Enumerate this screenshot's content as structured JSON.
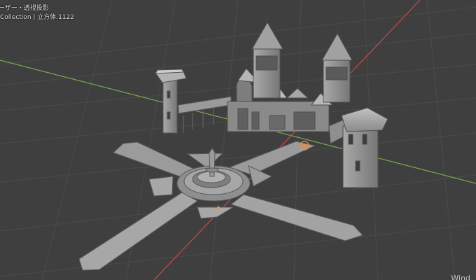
{
  "viewport": {
    "view_label": "ーザー・透視投影",
    "collection_label": "Collection | 立方体.1122",
    "watermark": "Wind"
  },
  "colors": {
    "background": "#3f3f3f",
    "grid": "#4a4a4a",
    "x_axis": "#c54a4a",
    "y_axis": "#7aa84a",
    "model_light": "#b3b3b3",
    "model_mid": "#8d8d8d",
    "model_dark": "#616161",
    "origin": "#ff8b2a"
  }
}
